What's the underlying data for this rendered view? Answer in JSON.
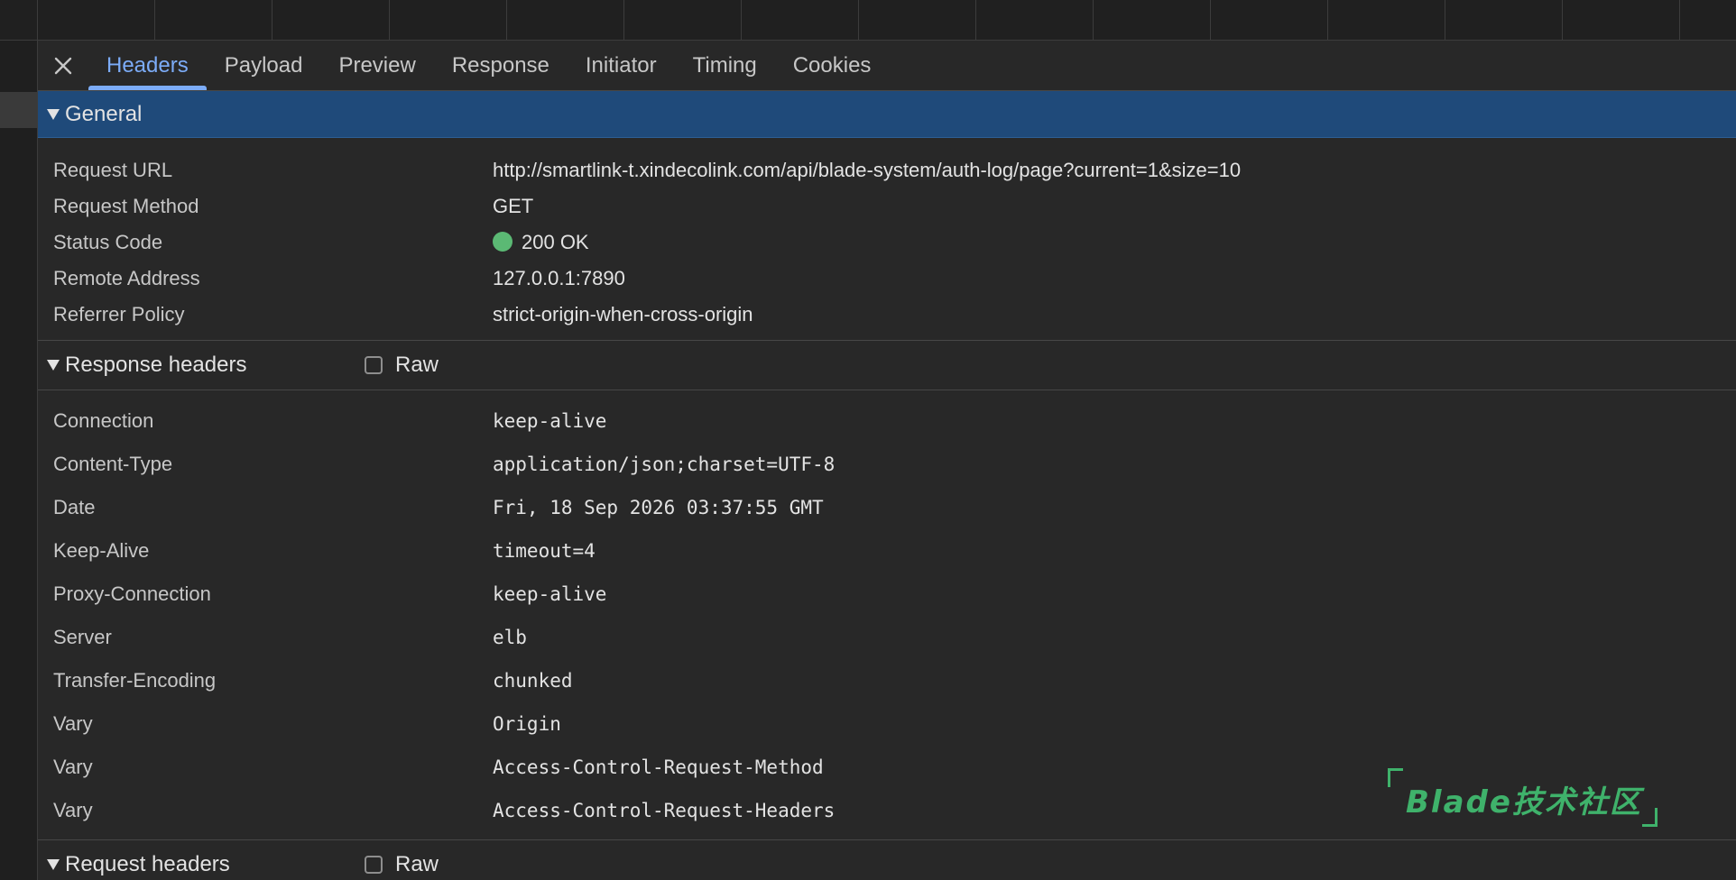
{
  "tabs": [
    {
      "label": "Headers",
      "active": true
    },
    {
      "label": "Payload",
      "active": false
    },
    {
      "label": "Preview",
      "active": false
    },
    {
      "label": "Response",
      "active": false
    },
    {
      "label": "Initiator",
      "active": false
    },
    {
      "label": "Timing",
      "active": false
    },
    {
      "label": "Cookies",
      "active": false
    }
  ],
  "general": {
    "title": "General",
    "rows": [
      {
        "key": "Request URL",
        "value": "http://smartlink-t.xindecolink.com/api/blade-system/auth-log/page?current=1&size=10"
      },
      {
        "key": "Request Method",
        "value": "GET"
      },
      {
        "key": "Status Code",
        "value": "200 OK"
      },
      {
        "key": "Remote Address",
        "value": "127.0.0.1:7890"
      },
      {
        "key": "Referrer Policy",
        "value": "strict-origin-when-cross-origin"
      }
    ]
  },
  "response_headers": {
    "title": "Response headers",
    "raw_label": "Raw",
    "raw_checked": false,
    "rows": [
      {
        "key": "Connection",
        "value": "keep-alive"
      },
      {
        "key": "Content-Type",
        "value": "application/json;charset=UTF-8"
      },
      {
        "key": "Date",
        "value": "Fri, 18 Sep 2026 03:37:55 GMT"
      },
      {
        "key": "Keep-Alive",
        "value": "timeout=4"
      },
      {
        "key": "Proxy-Connection",
        "value": "keep-alive"
      },
      {
        "key": "Server",
        "value": "elb"
      },
      {
        "key": "Transfer-Encoding",
        "value": "chunked"
      },
      {
        "key": "Vary",
        "value": "Origin"
      },
      {
        "key": "Vary",
        "value": "Access-Control-Request-Method"
      },
      {
        "key": "Vary",
        "value": "Access-Control-Request-Headers"
      }
    ]
  },
  "request_headers": {
    "title": "Request headers",
    "raw_label": "Raw",
    "raw_checked": false
  },
  "watermark": {
    "text": "Blade技术社区"
  },
  "colors": {
    "accent": "#7cacf8",
    "selected_section": "#1f4a7a",
    "status_ok": "#5bb974",
    "watermark": "#3fb26b"
  },
  "icons": {
    "close": "close-icon",
    "expand": "triangle-down-icon",
    "status": "status-dot-icon"
  }
}
